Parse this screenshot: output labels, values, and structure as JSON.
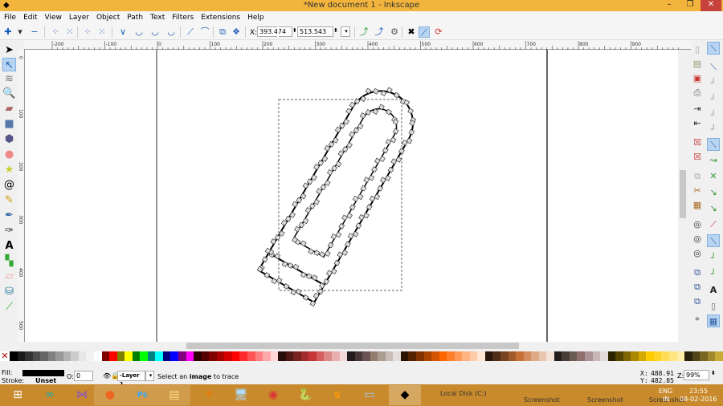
{
  "window": {
    "title": "*New document 1 - Inkscape",
    "minimize": "–",
    "restore": "❐",
    "close": "✕"
  },
  "menu": [
    "File",
    "Edit",
    "View",
    "Layer",
    "Object",
    "Path",
    "Text",
    "Filters",
    "Extensions",
    "Help"
  ],
  "toolbar": {
    "x_label": "X:",
    "x_value": "393.474",
    "y_label": "Y:",
    "y_value": "513.543",
    "unit": "px"
  },
  "ruler": {
    "h_labels": [
      "-200",
      "-100",
      "0",
      "100",
      "200",
      "300",
      "400",
      "500",
      "600",
      "700",
      "800",
      "900"
    ],
    "v_labels": [
      "0",
      "100",
      "200",
      "300",
      "400",
      "500"
    ]
  },
  "tools": [
    "selector-tool",
    "node-tool",
    "tweak-tool",
    "zoom-tool",
    "measure-tool",
    "rectangle-tool",
    "3d-box-tool",
    "ellipse-tool",
    "star-tool",
    "spiral-tool",
    "pencil-tool",
    "pen-tool",
    "calligraphy-tool",
    "text-tool",
    "spray-tool",
    "eraser-tool",
    "paint-bucket-tool",
    "connector-tool"
  ],
  "statusbar": {
    "fill_label": "Fill:",
    "stroke_label": "Stroke:",
    "stroke_value": "Unset",
    "fill_color": "#000000",
    "opacity_label": "O:",
    "opacity_value": "0",
    "layer": "-Layer 1",
    "message_pre": "Select an ",
    "message_bold": "image",
    "message_post": " to trace",
    "cursor_x_label": "X:",
    "cursor_x": "488.91",
    "cursor_y_label": "Y:",
    "cursor_y": "482.85",
    "zoom_label": "Z:",
    "zoom": "99%"
  },
  "palette": [
    "#000000",
    "#1a1a1a",
    "#333333",
    "#4d4d4d",
    "#666666",
    "#808080",
    "#999999",
    "#b3b3b3",
    "#cccccc",
    "#e6e6e6",
    "#f2f2f2",
    "#ffffff",
    "#800000",
    "#ff0000",
    "#808000",
    "#ffff00",
    "#008000",
    "#00ff00",
    "#008080",
    "#00ffff",
    "#000080",
    "#0000ff",
    "#800080",
    "#ff00ff",
    "#2b0000",
    "#550000",
    "#800000",
    "#aa0000",
    "#d40000",
    "#ff0000",
    "#ff2a2a",
    "#ff5555",
    "#ff8080",
    "#ffaaaa",
    "#ffd5d5",
    "#280b0b",
    "#501616",
    "#782121",
    "#a02c2c",
    "#c83737",
    "#d35f5f",
    "#de8787",
    "#e9afaf",
    "#f4d7d7",
    "#241c1c",
    "#483737",
    "#6c5353",
    "#917c6f",
    "#ac9d93",
    "#c8beb7",
    "#e3dedb",
    "#2b1100",
    "#552200",
    "#803300",
    "#aa4400",
    "#d45500",
    "#ff6600",
    "#ff7f2a",
    "#ff9955",
    "#ffb380",
    "#ffccaa",
    "#ffe6d5",
    "#28170b",
    "#502d16",
    "#784421",
    "#a05a2c",
    "#c87137",
    "#d38d5f",
    "#deaa87",
    "#e9c6af",
    "#f4e3d7",
    "#241f1c",
    "#483e37",
    "#6c5d53",
    "#916f6f",
    "#ac9393",
    "#c8b7b7",
    "#e3dbdb",
    "#2b2200",
    "#554400",
    "#806600",
    "#aa8800",
    "#d4aa00",
    "#ffcc00",
    "#ffd42a",
    "#ffdd55",
    "#ffe680",
    "#ffeeaa",
    "#28220b",
    "#504416",
    "#786721",
    "#a0892c",
    "#c8ab37"
  ],
  "taskbar": {
    "apps": [
      "windows-start",
      "arduino",
      "visual-studio",
      "firefox",
      "photoshop",
      "file-explorer",
      "app-orange",
      "network",
      "chrome",
      "python",
      "sublime",
      "screenshot-app",
      "inkscape"
    ],
    "tray_items": [
      "Local Disk (C:)",
      "Screenshot",
      "Screenshot",
      "Screenshot"
    ],
    "lang": "ENG",
    "lang2": "IN",
    "time": "23:55",
    "date": "08-02-2016"
  }
}
